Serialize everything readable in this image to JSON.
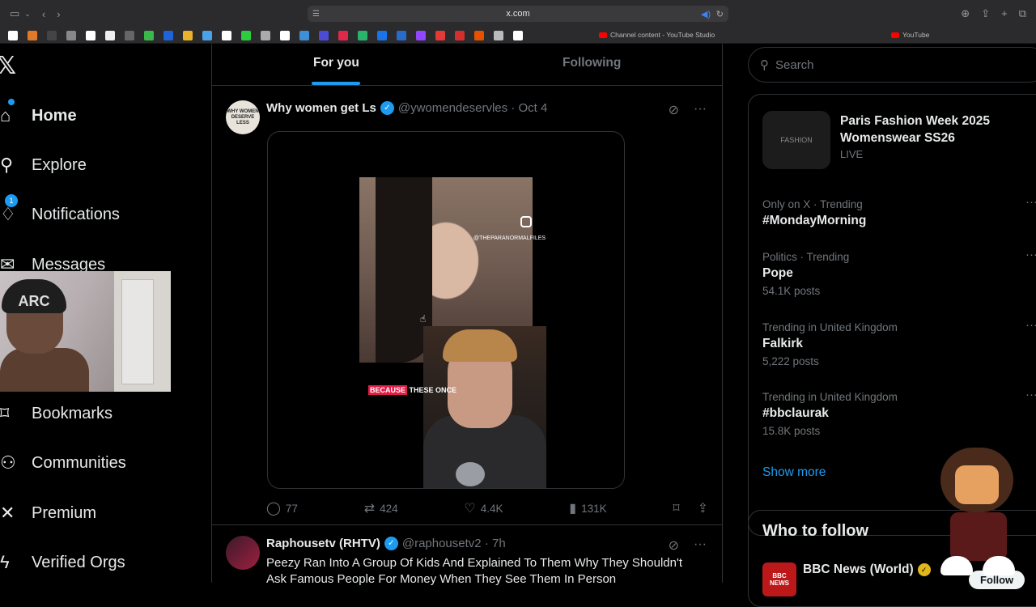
{
  "browser": {
    "url": "x.com",
    "tabs": [
      {
        "label": "Channel content - YouTube Studio"
      },
      {
        "label": "YouTube"
      }
    ]
  },
  "nav": {
    "items": [
      {
        "label": "Home",
        "icon": "home-icon"
      },
      {
        "label": "Explore",
        "icon": "search-icon"
      },
      {
        "label": "Notifications",
        "icon": "bell-icon",
        "badge": "1"
      },
      {
        "label": "Messages",
        "icon": "mail-icon"
      },
      {
        "label": "Bookmarks",
        "icon": "bookmark-icon"
      },
      {
        "label": "Communities",
        "icon": "people-icon"
      },
      {
        "label": "Premium",
        "icon": "x-logo-icon"
      },
      {
        "label": "Verified Orgs",
        "icon": "lightning-icon"
      }
    ]
  },
  "feed": {
    "tabs": [
      "For you",
      "Following"
    ],
    "tweets": [
      {
        "name": "Why women get Ls",
        "handle": "@ywomendeservles",
        "time": "Oct 4",
        "avatar_text": "WHY WOMEN DESERVE LESS",
        "video": {
          "watermark": "@THEPARANORMALFILES",
          "caption_highlight": "BECAUSE",
          "caption_rest": " THESE ONCE"
        },
        "replies": "77",
        "reposts": "424",
        "likes": "4.4K",
        "views": "131K"
      },
      {
        "name": "Raphousetv (RHTV)",
        "handle": "@raphousetv2",
        "time": "7h",
        "text": "Peezy Ran Into A Group Of Kids And Explained To Them Why They Shouldn't Ask Famous People For Money When They See Them In Person"
      }
    ]
  },
  "sidebar": {
    "search_placeholder": "Search",
    "featured": {
      "title": "Paris Fashion Week 2025 Womenswear SS26",
      "status": "LIVE",
      "thumb_text": "FASHION"
    },
    "trends": [
      {
        "context": "Only on X · Trending",
        "name": "#MondayMorning",
        "count": ""
      },
      {
        "context": "Politics · Trending",
        "name": "Pope",
        "count": "54.1K posts"
      },
      {
        "context": "Trending in United Kingdom",
        "name": "Falkirk",
        "count": "5,222 posts"
      },
      {
        "context": "Trending in United Kingdom",
        "name": "#bbclaurak",
        "count": "15.8K posts"
      }
    ],
    "show_more": "Show more",
    "who_to_follow": {
      "title": "Who to follow",
      "account": "BBC News (World)",
      "logo_text": "BBC NEWS",
      "button": "Follow"
    }
  },
  "colors": {
    "accent": "#1d9bf0",
    "background": "#000000",
    "border": "#2f3336",
    "muted": "#71767b"
  }
}
